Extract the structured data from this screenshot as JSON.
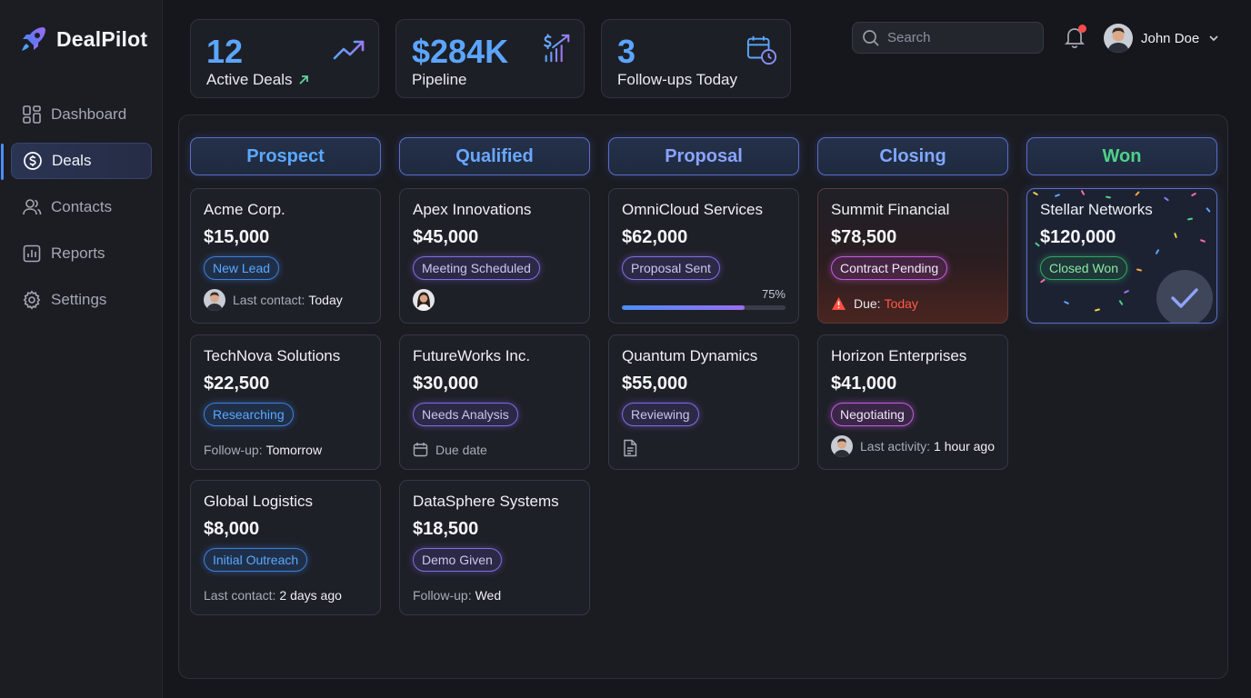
{
  "app": {
    "name": "DealPilot"
  },
  "nav": {
    "items": [
      {
        "label": "Dashboard",
        "icon": "dashboard-icon",
        "active": false
      },
      {
        "label": "Deals",
        "icon": "dollar-circle-icon",
        "active": true
      },
      {
        "label": "Contacts",
        "icon": "contacts-icon",
        "active": false
      },
      {
        "label": "Reports",
        "icon": "reports-icon",
        "active": false
      },
      {
        "label": "Settings",
        "icon": "gear-icon",
        "active": false
      }
    ]
  },
  "stats": [
    {
      "value": "12",
      "label": "Active Deals",
      "icon": "trend-up-icon"
    },
    {
      "value": "$284K",
      "label": "Pipeline",
      "icon": "revenue-chart-icon"
    },
    {
      "value": "3",
      "label": "Follow-ups Today",
      "icon": "calendar-clock-icon"
    }
  ],
  "search": {
    "placeholder": "Search"
  },
  "user": {
    "name": "John Doe"
  },
  "columns": [
    {
      "title": "Prospect",
      "color": "#5aa8ff",
      "cards": [
        {
          "name": "Acme Corp.",
          "amount": "$15,000",
          "tag": "New Lead",
          "tag_style": "blue",
          "foot_label": "Last contact:",
          "foot_value": "Today",
          "foot_icon": "avatar"
        },
        {
          "name": "TechNova Solutions",
          "amount": "$22,500",
          "tag": "Researching",
          "tag_style": "blue",
          "foot_label": "Follow-up:",
          "foot_value": "Tomorrow",
          "foot_icon": ""
        },
        {
          "name": "Global Logistics",
          "amount": "$8,000",
          "tag": "Initial Outreach",
          "tag_style": "blue",
          "foot_label": "Last contact:",
          "foot_value": "2 days ago",
          "foot_icon": ""
        }
      ]
    },
    {
      "title": "Qualified",
      "color": "#6aa7ff",
      "cards": [
        {
          "name": "Apex Innovations",
          "amount": "$45,000",
          "tag": "Meeting Scheduled",
          "tag_style": "purple",
          "foot_label": "",
          "foot_value": "",
          "foot_icon": "avatar-female"
        },
        {
          "name": "FutureWorks Inc.",
          "amount": "$30,000",
          "tag": "Needs Analysis",
          "tag_style": "purple",
          "foot_label": "Due date",
          "foot_value": "",
          "foot_icon": "calendar-icon"
        },
        {
          "name": "DataSphere Systems",
          "amount": "$18,500",
          "tag": "Demo Given",
          "tag_style": "purple",
          "foot_label": "Follow-up:",
          "foot_value": "Wed",
          "foot_icon": ""
        }
      ]
    },
    {
      "title": "Proposal",
      "color": "#8aa3ff",
      "cards": [
        {
          "name": "OmniCloud Services",
          "amount": "$62,000",
          "tag": "Proposal Sent",
          "tag_style": "purple",
          "progress_label": "75%",
          "progress": 0.75
        },
        {
          "name": "Quantum Dynamics",
          "amount": "$55,000",
          "tag": "Reviewing",
          "tag_style": "purple",
          "foot_label": "",
          "foot_value": "",
          "foot_icon": "document-icon"
        }
      ]
    },
    {
      "title": "Closing",
      "color": "#7fa8ff",
      "cards": [
        {
          "name": "Summit Financial",
          "amount": "$78,500",
          "tag": "Contract Pending",
          "tag_style": "magenta",
          "foot_label": "Due:",
          "foot_value": "Today",
          "foot_icon": "warning-icon",
          "urgent": true
        },
        {
          "name": "Horizon Enterprises",
          "amount": "$41,000",
          "tag": "Negotiating",
          "tag_style": "magenta",
          "foot_label": "Last activity:",
          "foot_value": "1 hour ago",
          "foot_icon": "avatar"
        }
      ]
    },
    {
      "title": "Won",
      "color": "#4fd08a",
      "cards": [
        {
          "name": "Stellar Networks",
          "amount": "$120,000",
          "tag": "Closed Won",
          "tag_style": "green",
          "won": true
        }
      ]
    }
  ]
}
